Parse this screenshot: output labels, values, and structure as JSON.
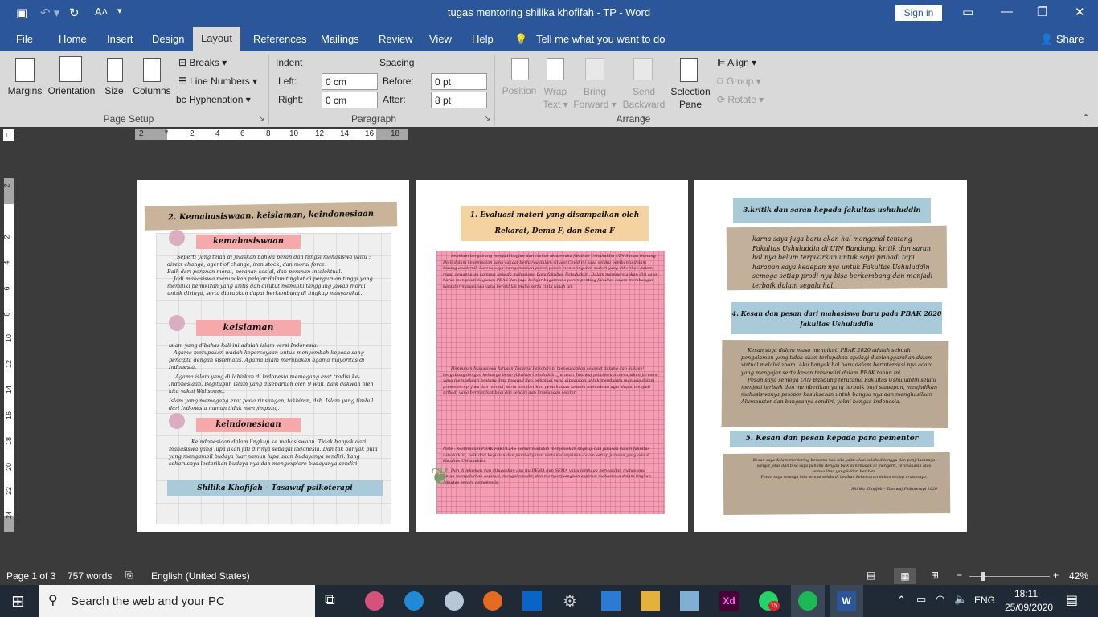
{
  "title_bar": {
    "doc_title": "tugas mentoring shilika khofifah  -  TP  -  Word",
    "sign_in": "Sign in"
  },
  "tabs": [
    "File",
    "Home",
    "Insert",
    "Design",
    "Layout",
    "References",
    "Mailings",
    "Review",
    "View",
    "Help"
  ],
  "tell_me": "Tell me what you want to do",
  "share": "Share",
  "ribbon": {
    "page_setup": {
      "margins": "Margins",
      "orientation": "Orientation",
      "size": "Size",
      "columns": "Columns",
      "breaks": "Breaks",
      "line_numbers": "Line Numbers",
      "hyphenation": "Hyphenation",
      "group": "Page Setup"
    },
    "paragraph": {
      "indent": "Indent",
      "left_label": "Left:",
      "left_value": "0 cm",
      "right_label": "Right:",
      "right_value": "0 cm",
      "spacing": "Spacing",
      "before_label": "Before:",
      "before_value": "0 pt",
      "after_label": "After:",
      "after_value": "8 pt",
      "group": "Paragraph"
    },
    "arrange": {
      "position": "Position",
      "wrap_text": "Wrap Text",
      "wrap_a": "Wrap",
      "wrap_b": "Text",
      "bring_a": "Bring",
      "bring_b": "Forward",
      "send_a": "Send",
      "send_b": "Backward",
      "selection_a": "Selection",
      "selection_b": "Pane",
      "align": "Align",
      "group_btn": "Group",
      "rotate": "Rotate",
      "group": "Arrange"
    }
  },
  "ruler_numbers": [
    "2",
    "2",
    "4",
    "6",
    "8",
    "10",
    "12",
    "14",
    "16",
    "18"
  ],
  "vruler_numbers": [
    "2",
    "2",
    "4",
    "6",
    "8",
    "10",
    "12",
    "14",
    "16",
    "18",
    "20",
    "22",
    "24"
  ],
  "page1": {
    "heading": "2.  Kemahasiswaan, keislaman, keindonesiaan",
    "s1_title": "kemahasiswaan",
    "s1_p1": "Seperti yang telah di jelaskan bahwa  peran dan fungsi mahasiswa yaitu : direct change, agent of change, iron stock, dan moral force.",
    "s1_p2": "Baik dari peranan moral, peranan  sosial, dan peranan intelektual.",
    "s1_p3": "Jadi mahasiswa merupakan pelajar dalam tingkat di perguruan tinggi yang memiliki pemikiran yang kritis dan ditutut memiliki tanggung jawab moral untuk dirinya, serta diarapkan dapat berkembang di lingkup masyarakat.",
    "s2_title": "keislaman",
    "s2_p1": "islam yang dibahas kali ini adalah islam versi Indonesia.",
    "s2_p2": "Agama merupakan wadah kepercayaan untuk menyembah kepada sang pencipta dengan sistematis. Agama islam merupakan agama mayoritas di Indonesia.",
    "s2_p3": "Agama islam yang di lahirkan di Indonesia memegang erat tradisi ke- Indonesiaan. Begitupun islam yang disebarkan oleh 9 wali, baik dakwah oleh kita yakni Walisongo.",
    "s2_p4": "Islam yang memegang erat pada rinsangan, takbiran, dsb. Islam yang timbul dari Indonesia namun tidak menyimpang.",
    "s3_title": "keindonesiaan",
    "s3_p1": "Keindonesiaan dalam lingkup ke mahasiswaan. Tidak banyak dari mahasiswa yang lupa akan jati dirinya sebagai indonesia. Dan tak banyak pula yang mengambil budaya luar namun lupa akan budayanya sendiri. Yang seharusnya lestarikan budaya nya dan mengexplore budayanya sendiri.",
    "footer": "Shilika Khofifah – Tasawuf psikoterapi"
  },
  "page2": {
    "heading_a": "1.    Evaluasi materi yang disampaikan oleh",
    "heading_b": "Rekarat, Dema F, dan Sema F",
    "p1": "Sebelum bergabung menjadi bagian dari civitas akademika fakultas Ushuluddin UIN Sunan Gunung Djati dalam kesempatan yang sangat berharga dalam situasi Covid ini saya selaku pembantu dalam bidang akademik karena saya mengamatkan pokok-pokok mentoring dan materi yang diberikan dalam masa pengenalan kampus kepada mahasiswa baru fakultas Ushuluddin. Dalam mempersiapkan diri saya harus mengikuti kegiatan PBAK dan juga belajar bagaimana peran penting fakultas dalam membangun karakter mahasiswa yang berakhlak mulia serta cinta tanah air.",
    "p2": "Himpunan Mahasiswa Jurusan Tasawuf Psikoterapi mengucapkan selamat datang dan Sukses! bergabung dengan keluarga besar fakultas Ushuluddin. Jurusan Tasawuf psikoterapi merupakan jurusan yang mempelajari tentang ilmu tasawuf dan psikologi yang dipadukan untuk membantu manusia dalam proses terapi jiwa dan mental, serta memberikan pemahaman kepada mahasiswa agar dapat menjadi pribadi yang bermanfaat bagi diri sendiri dan lingkungan sekitar.",
    "p3": "Note : kesimpulan PBAK FAKULTAS kemarin adalah menjelaskan lingkup dan jurusan dalam fakultas ushuluddin, baik dari kegiatan dan pembelajaran serta kedisiplinan dalam setiap jurusan yang ada di Fakultas Ushuluddin.",
    "p4": "Dan di jelaskan dan ditugaskan apa itu DEMA dan SEMA yaitu lembaga perwakilan mahasiswa untuk menyalurkan aspirasi, mengakomodir, dan memperjuangkan aspirasi mahasiswa dalam lingkup fakultas secara demokratis."
  },
  "page3": {
    "h3": "3.kritik dan saran kepada fakultas ushuluddin",
    "t3": "karna saya juga baru akan hal mengenal tentang Fakultas Ushuluddin di UIN Bandung, kritik dan saran hal nya belum terpikirkan untuk saya pribadi tapi harapan saya kedepan nya untuk Fakultas Ushuluddin semoga setiap prodi nya bisa berkembang dan menjadi terbaik dalam segala hal.",
    "h4a": "4. Kesan dan pesan dari mahasiswa baru pada PBAK 2020",
    "h4b": "fakultas Ushuluddin",
    "t4a": "Kesan saya dalam masa mengikuti PBAK 2020 adalah sebuah pengalaman yang tidak akan terlupakan apalagi diselenggarakan dalam virtual melalui zoom. Aku banyak hal baru dalam berinteraksi nya acara yang mengajar serta kesan tersendiri dalam PBAK tahun ini.",
    "t4b": "Pesan saya semoga UIN Bandung terutama Fakultas Ushuluddin selalu menjadi terbaik dan memberikan yang terbaik bagi siapapun, menjadikan mahasiswanya pelopor kesuksesan untuk bangsa nya dan menghasilkan Alumnuster dan bangsanya sendiri, yakni bangsa Indonesia.",
    "h5": "5.  Kesan dan pesan kepada para pementor",
    "t5": "Kesan saya dalam mentoring bersama kak bila yaitu akan selalu ditunggu dan penjelasannya sangat jelas dan bisa saya pahami dengan baik dan mudah di mengerti, terimakasih atas semua ilmu yang kalian berikan.",
    "t5b": "Pesan saya semoga kita semua selalu di berikan kelancaran dalam setiap urusannya.",
    "sig": "Shilika Khofifah – Tasawuf Psikoterapi 2020"
  },
  "status": {
    "page": "Page 1 of 3",
    "words": "757 words",
    "language": "English (United States)",
    "zoom": "42%"
  },
  "taskbar": {
    "search": "Search the web and your PC",
    "lang": "ENG",
    "time": "18:11",
    "date": "25/09/2020",
    "whatsapp_badge": "15"
  },
  "colors": {
    "word_blue": "#2b579a",
    "ribbon_gray": "#d9d9d9",
    "tape_tan": "#c9b49a",
    "tape_blue": "#a9cbd9",
    "tape_pink": "#f5a9ab",
    "pink_paper": "#f29fb0"
  }
}
